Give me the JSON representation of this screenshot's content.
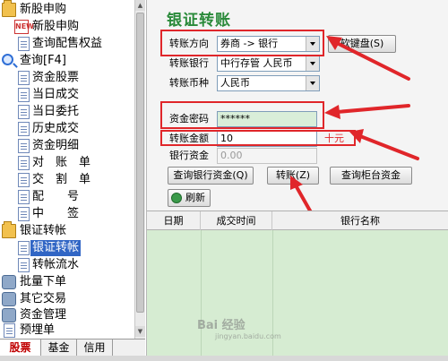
{
  "tree": {
    "items": [
      {
        "label": "新股申购",
        "icon": "folder-icon"
      },
      {
        "label": "新股申购",
        "icon": "new-icon"
      },
      {
        "label": "查询配售权益",
        "icon": "document-icon"
      },
      {
        "label": "查询[F4]",
        "icon": "search-icon"
      },
      {
        "label": "资金股票",
        "icon": "document-icon"
      },
      {
        "label": "当日成交",
        "icon": "document-icon"
      },
      {
        "label": "当日委托",
        "icon": "document-icon"
      },
      {
        "label": "历史成交",
        "icon": "document-icon"
      },
      {
        "label": "资金明细",
        "icon": "document-icon"
      },
      {
        "label": "对　账　单",
        "icon": "document-icon"
      },
      {
        "label": "交　割　单",
        "icon": "document-icon"
      },
      {
        "label": "配　　号",
        "icon": "document-icon"
      },
      {
        "label": "中　　签",
        "icon": "document-icon"
      },
      {
        "label": "银证转帐",
        "icon": "folder-icon"
      },
      {
        "label": "银证转帐",
        "icon": "document-icon",
        "selected": true
      },
      {
        "label": "转帐流水",
        "icon": "document-icon"
      },
      {
        "label": "批量下单",
        "icon": "gear-icon"
      },
      {
        "label": "其它交易",
        "icon": "gear-icon"
      },
      {
        "label": "资金管理",
        "icon": "gear-icon"
      },
      {
        "label": "预埋单",
        "icon": "document-icon"
      }
    ]
  },
  "bottom_tabs": [
    "股票",
    "基金",
    "信用"
  ],
  "form": {
    "title": "银证转账",
    "direction_label": "转账方向",
    "direction_value": "券商 -> 银行",
    "bank_label": "转账银行",
    "bank_value": "中行存管 人民币",
    "currency_label": "转账币种",
    "currency_value": "人民币",
    "keyboard_button": "软键盘(S)",
    "password_label": "资金密码",
    "password_value": "******",
    "amount_label": "转账金额",
    "amount_value": "10",
    "amount_unit": "十元",
    "bank_funds_label": "银行资金",
    "bank_funds_value": "0.00",
    "query_bank_button": "查询银行资金(Q)",
    "transfer_button": "转账(Z)",
    "query_counter_button": "查询柜台资金",
    "refresh_button": "刷新"
  },
  "table": {
    "columns": [
      "日期",
      "成交时间",
      "银行名称"
    ]
  },
  "watermark": {
    "text": "Bai 经验",
    "domain": "jingyan.baidu.com"
  },
  "colors": {
    "title": "#2a8a3a",
    "annotation": "#e0262a",
    "grid": "#d6ecd2",
    "selection": "#3166c5"
  }
}
